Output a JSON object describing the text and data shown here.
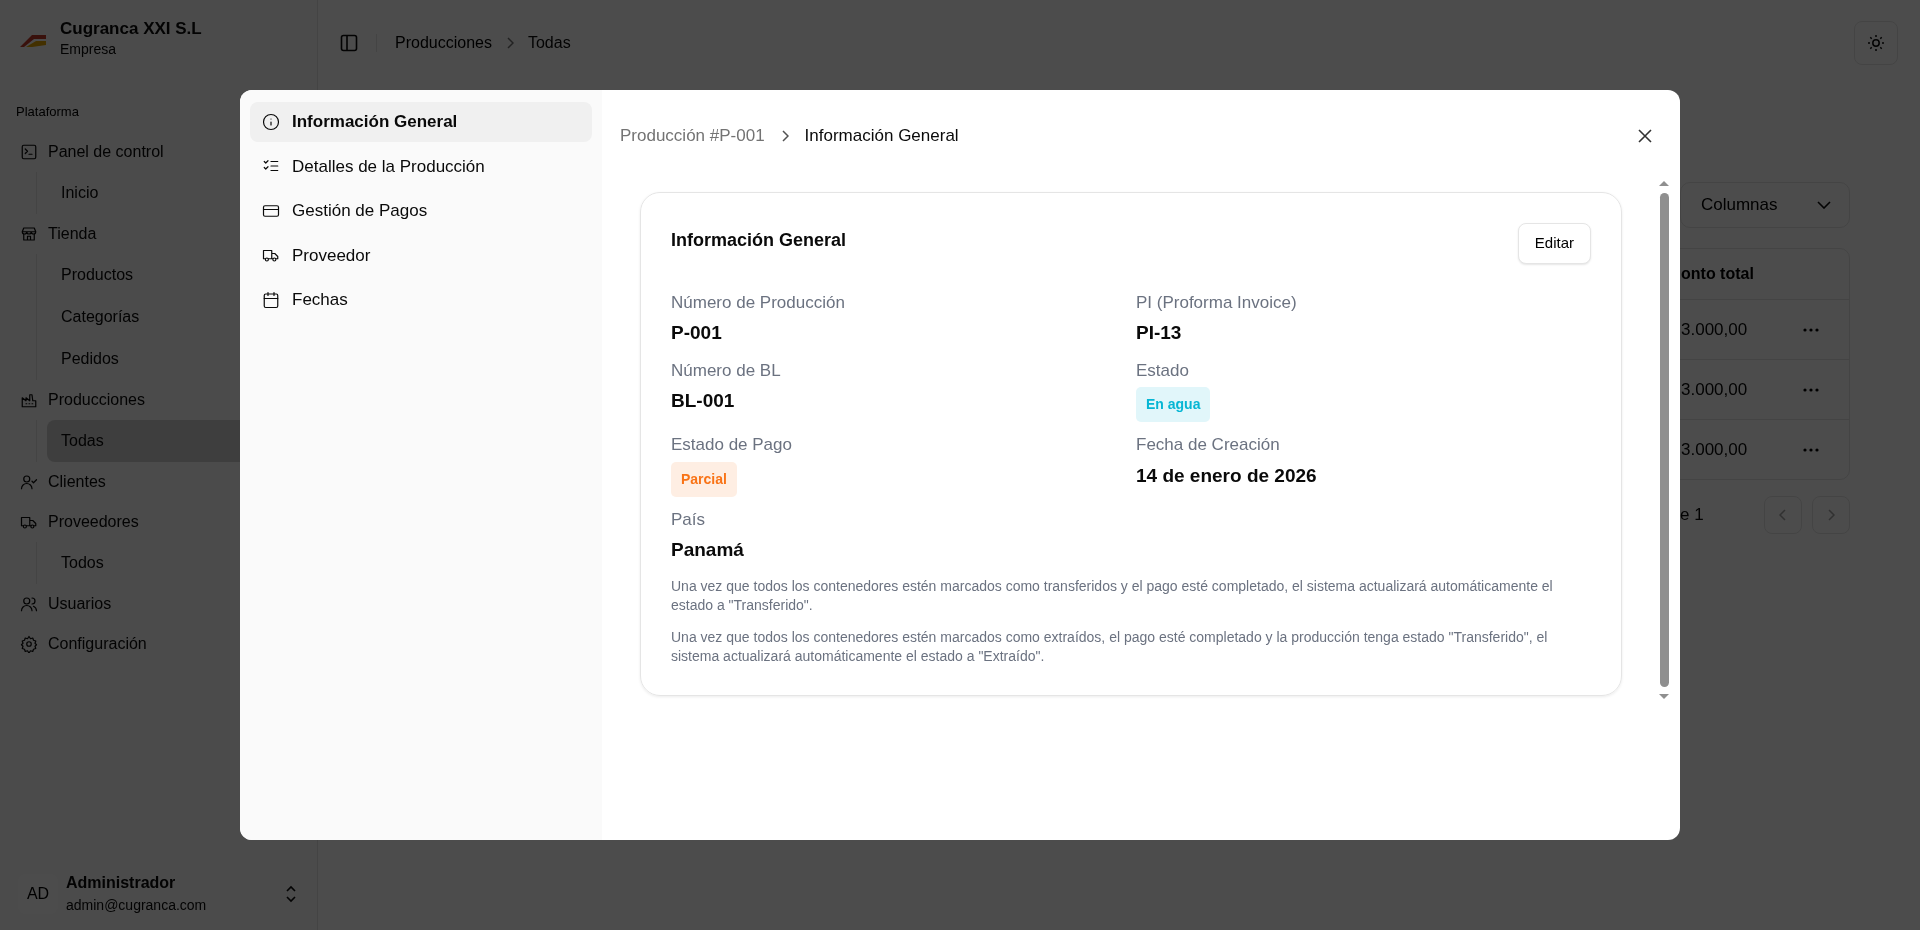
{
  "sidebar": {
    "company": {
      "name": "Cugranca XXI S.L",
      "subtitle": "Empresa"
    },
    "group_label": "Plataforma",
    "items": [
      {
        "label": "Panel de control",
        "selected": false,
        "children": [
          {
            "label": "Inicio",
            "selected": false
          }
        ]
      },
      {
        "label": "Tienda",
        "selected": false,
        "children": [
          {
            "label": "Productos",
            "selected": false
          },
          {
            "label": "Categorías",
            "selected": false
          },
          {
            "label": "Pedidos",
            "selected": false
          }
        ]
      },
      {
        "label": "Producciones",
        "selected": false,
        "children": [
          {
            "label": "Todas",
            "selected": true
          }
        ]
      },
      {
        "label": "Clientes",
        "selected": false
      },
      {
        "label": "Proveedores",
        "selected": false,
        "children": [
          {
            "label": "Todos",
            "selected": false
          }
        ]
      },
      {
        "label": "Usuarios",
        "selected": false
      },
      {
        "label": "Configuración",
        "selected": false
      }
    ],
    "user": {
      "initials": "AD",
      "name": "Administrador",
      "email": "admin@cugranca.com"
    }
  },
  "header": {
    "breadcrumb": [
      "Producciones",
      "Todas"
    ]
  },
  "toolbar": {
    "columns_button": "Columnas"
  },
  "table": {
    "column": "onto total",
    "rows": [
      {
        "amount": "3.000,00"
      },
      {
        "amount": "3.000,00"
      },
      {
        "amount": "3.000,00"
      }
    ]
  },
  "pagination": {
    "text": "e 1"
  },
  "modal": {
    "nav": [
      {
        "label": "Información General",
        "selected": true
      },
      {
        "label": "Detalles de la Producción",
        "selected": false
      },
      {
        "label": "Gestión de Pagos",
        "selected": false
      },
      {
        "label": "Proveedor",
        "selected": false
      },
      {
        "label": "Fechas",
        "selected": false
      }
    ],
    "breadcrumb": [
      "Producción #P-001",
      "Información General"
    ],
    "card": {
      "title": "Información General",
      "edit_button": "Editar",
      "fields": [
        {
          "label": "Número de Producción",
          "value": "P-001",
          "kind": "text"
        },
        {
          "label": "PI (Proforma Invoice)",
          "value": "PI-13",
          "kind": "text"
        },
        {
          "label": "Número de BL",
          "value": "BL-001",
          "kind": "text"
        },
        {
          "label": "Estado",
          "value": "En agua",
          "kind": "badge",
          "color": "#06b6d4"
        },
        {
          "label": "Estado de Pago",
          "value": "Parcial",
          "kind": "badge",
          "color": "#f97316"
        },
        {
          "label": "Fecha de Creación",
          "value": "14 de enero de 2026",
          "kind": "text"
        },
        {
          "label": "País",
          "value": "Panamá",
          "kind": "text"
        }
      ],
      "notes": [
        "Una vez que todos los contenedores estén marcados como transferidos y el pago esté completado, el sistema actualizará automáticamente el estado a \"Transferido\".",
        "Una vez que todos los contenedores estén marcados como extraídos, el pago esté completado y la producción tenga estado \"Transferido\", el sistema actualizará automáticamente el estado a \"Extraído\"."
      ]
    }
  }
}
